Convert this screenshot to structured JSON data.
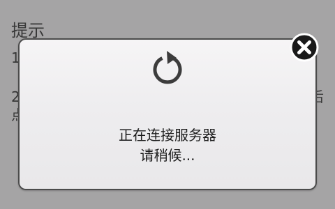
{
  "background": {
    "title": "提示",
    "line1": "1",
    "line2": "2",
    "line2_cont": "点",
    "line2_right": "后"
  },
  "dialog": {
    "icon": "refresh-icon",
    "message_line1": "正在连接服务器",
    "message_line2": "请稍候..."
  },
  "close_button": {
    "icon": "close-icon"
  },
  "colors": {
    "background": "#a5a4a5",
    "dialog_fill": "#eeedef",
    "dialog_border": "#4b4b4b",
    "icon": "#3c3c3c",
    "close_fill": "#1a1a1a"
  }
}
